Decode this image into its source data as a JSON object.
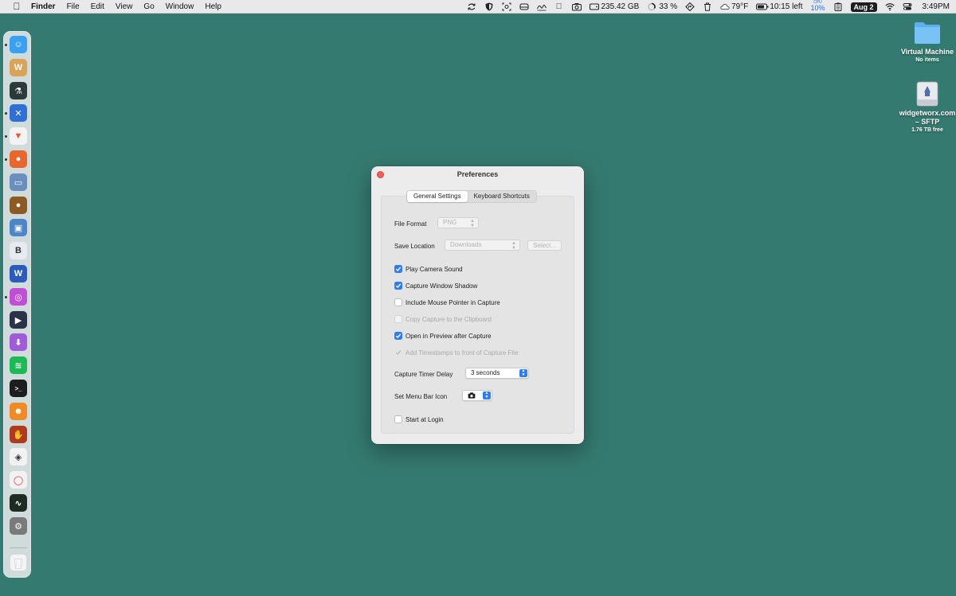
{
  "menubar": {
    "app_name": "Finder",
    "menus": [
      "File",
      "Edit",
      "View",
      "Go",
      "Window",
      "Help"
    ],
    "status": {
      "disk_free": "235.42 GB",
      "percent": "33 %",
      "weather": "79°F",
      "battery": "10:15 left",
      "cpu_label": "CPU",
      "cpu_value": "10%",
      "date": "Aug 2",
      "time": "3:49PM"
    }
  },
  "desktop": {
    "icons": [
      {
        "name": "Virtual Machine",
        "sub": "No items"
      },
      {
        "name": "widgetworx.com – SFTP",
        "sub": "1.76 TB free"
      }
    ]
  },
  "dock": {
    "apps": [
      {
        "name": "finder-icon",
        "color": "#3aa0f2"
      },
      {
        "name": "word-processor-icon",
        "color": "#d9a457"
      },
      {
        "name": "flask-icon",
        "color": "#2b3a3a"
      },
      {
        "name": "tools-icon",
        "color": "#2f6fd8"
      },
      {
        "name": "brave-icon",
        "color": "#f3f3f3"
      },
      {
        "name": "firefox-icon",
        "color": "#e9672c"
      },
      {
        "name": "screenshot-app-icon",
        "color": "#6a8fbf"
      },
      {
        "name": "acorn-icon",
        "color": "#8c5a22"
      },
      {
        "name": "preview-icon",
        "color": "#4a86c8"
      },
      {
        "name": "bbedit-icon",
        "color": "#e8eaf2"
      },
      {
        "name": "word-icon",
        "color": "#2b5cbd"
      },
      {
        "name": "arc-icon",
        "color": "#c04fd6"
      },
      {
        "name": "video-player-icon",
        "color": "#2a3347"
      },
      {
        "name": "downloader-icon",
        "color": "#9f5bd8"
      },
      {
        "name": "spotify-icon",
        "color": "#1db954"
      },
      {
        "name": "terminal-icon",
        "color": "#1d1d1f"
      },
      {
        "name": "beta-app-icon",
        "color": "#f08a24"
      },
      {
        "name": "hands-icon",
        "color": "#b03a1e"
      },
      {
        "name": "layers-icon",
        "color": "#f2f2f2"
      },
      {
        "name": "ring-icon",
        "color": "#f2f2f2"
      },
      {
        "name": "activity-monitor-icon",
        "color": "#1d2b22"
      },
      {
        "name": "system-settings-icon",
        "color": "#7a7a7a"
      }
    ]
  },
  "prefs": {
    "title": "Preferences",
    "tabs": [
      "General Settings",
      "Keyboard Shortcuts"
    ],
    "file_format_label": "File Format",
    "file_format_value": "PNG",
    "save_location_label": "Save Location",
    "save_location_value": "Downloads",
    "select_button": "Select...",
    "checkboxes": [
      {
        "label": "Play Camera Sound",
        "checked": true,
        "enabled": true
      },
      {
        "label": "Capture Window Shadow",
        "checked": true,
        "enabled": true
      },
      {
        "label": "Include Mouse Pointer in Capture",
        "checked": false,
        "enabled": true
      },
      {
        "label": "Copy Capture to the Clipboard",
        "checked": false,
        "enabled": false
      },
      {
        "label": "Open in Preview after Capture",
        "checked": true,
        "enabled": true
      },
      {
        "label": "Add Timestamps to front of Capture File",
        "checked": true,
        "enabled": false
      }
    ],
    "timer_label": "Capture Timer Delay",
    "timer_value": "3 seconds",
    "menubar_icon_label": "Set Menu Bar Icon",
    "start_login_label": "Start at Login",
    "start_login_checked": false
  }
}
